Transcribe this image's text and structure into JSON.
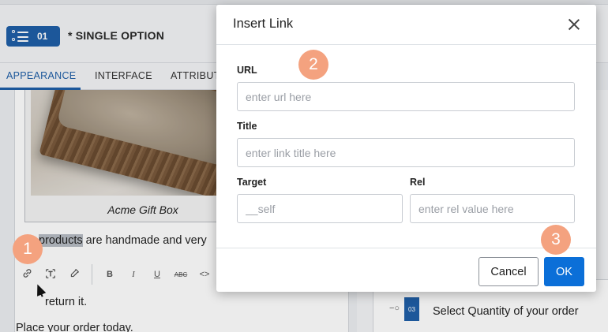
{
  "header": {
    "step_number": "01",
    "title": "* SINGLE OPTION"
  },
  "tabs": [
    {
      "label": "APPEARANCE",
      "active": true
    },
    {
      "label": "INTERFACE",
      "active": false
    },
    {
      "label": "ATTRIBUTE",
      "active": false
    }
  ],
  "editor": {
    "caption": "Acme Gift Box",
    "para1_highlight": "products",
    "para1_rest": " are handmade and very",
    "para2": "return it.",
    "para3": "Place your order today.",
    "toolbar": [
      "link-icon",
      "text-box-icon",
      "eyedropper-icon",
      "bold-icon",
      "italic-icon",
      "underline-icon",
      "strikethrough-icon",
      "code-icon"
    ]
  },
  "right_panel": {
    "step_number": "03",
    "step_text": "Select Quantity of your order"
  },
  "modal": {
    "title": "Insert Link",
    "url_label": "URL",
    "url_placeholder": "enter url here",
    "title_label": "Title",
    "title_placeholder": "enter link title here",
    "target_label": "Target",
    "target_placeholder": "__self",
    "rel_label": "Rel",
    "rel_placeholder": "enter rel value here",
    "cancel_label": "Cancel",
    "ok_label": "OK"
  },
  "markers": [
    "1",
    "2",
    "3"
  ],
  "colors": {
    "accent": "#1f5fa8",
    "primary_button": "#0b6fd8",
    "marker": "#f4a27f"
  }
}
